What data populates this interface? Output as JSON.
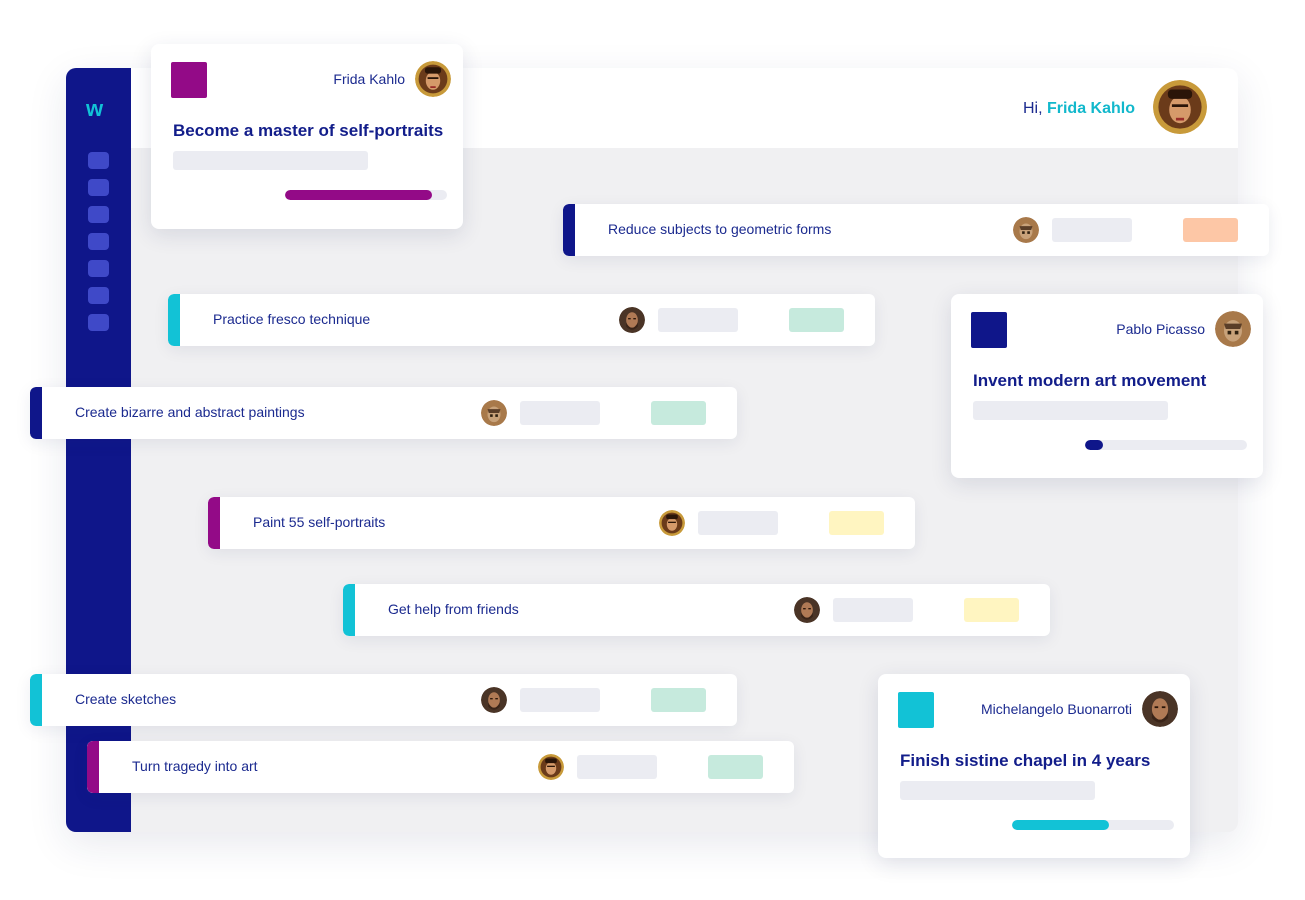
{
  "app": {
    "logo": "w",
    "greeting_prefix": "Hi, ",
    "user_name": "Frida Kahlo"
  },
  "colors": {
    "navy": "#0f168a",
    "cyan": "#12c2d6",
    "magenta": "#930a87",
    "peach": "#fdc7a6",
    "mint": "#c6eadd",
    "yellow": "#fff5c1"
  },
  "rows": [
    {
      "label": "Reduce subjects to geometric forms",
      "avatar": "pablo-picasso-avatar",
      "tag_color": "#fdc7a6",
      "accent": "#0f168a"
    },
    {
      "label": "Practice fresco technique",
      "avatar": "michelangelo-avatar",
      "tag_color": "#c6eadd",
      "accent": "#12c2d6"
    },
    {
      "label": "Create bizarre and abstract paintings",
      "avatar": "pablo-picasso-avatar",
      "tag_color": "#c6eadd",
      "accent": "#0f168a"
    },
    {
      "label": "Paint 55 self-portraits",
      "avatar": "frida-kahlo-avatar",
      "tag_color": "#fff5c1",
      "accent": "#930a87"
    },
    {
      "label": "Get help from friends",
      "avatar": "michelangelo-avatar",
      "tag_color": "#fff5c1",
      "accent": "#12c2d6"
    },
    {
      "label": "Create sketches",
      "avatar": "michelangelo-avatar",
      "tag_color": "#c6eadd",
      "accent": "#12c2d6"
    },
    {
      "label": "Turn tragedy into art",
      "avatar": "frida-kahlo-avatar",
      "tag_color": "#c6eadd",
      "accent": "#930a87"
    }
  ],
  "cards": [
    {
      "owner": "Frida Kahlo",
      "title": "Become a master of self-portraits",
      "color": "#930a87",
      "progress": 0.91
    },
    {
      "owner": "Pablo Picasso",
      "title": "Invent modern art movement",
      "color": "#0f168a",
      "progress": 0.11
    },
    {
      "owner": "Michelangelo Buonarroti",
      "title": "Finish sistine chapel in 4 years",
      "color": "#12c2d6",
      "progress": 0.6
    }
  ]
}
